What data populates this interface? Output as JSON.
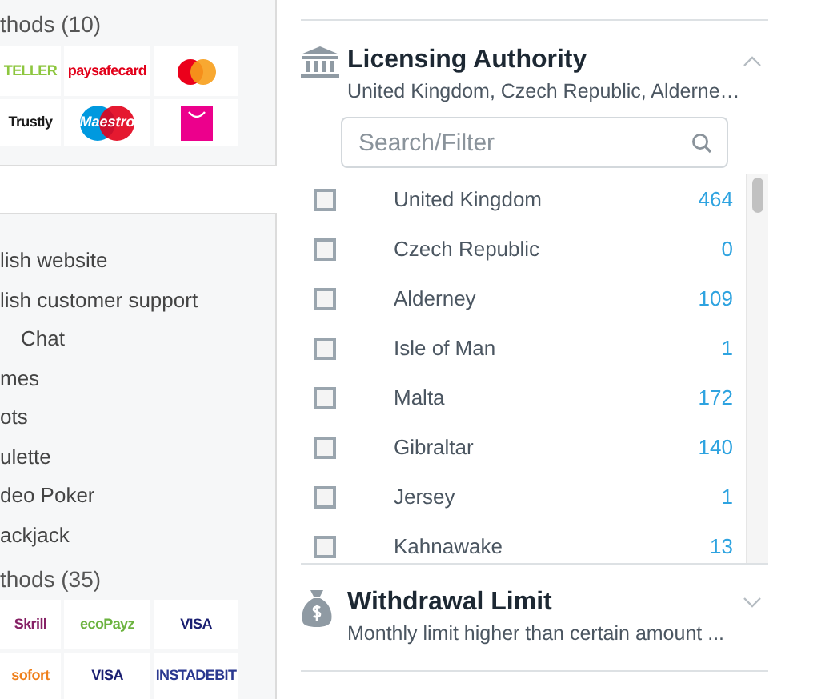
{
  "payment_card_top": {
    "heading": "thods (10)",
    "logos": [
      {
        "kind": "text",
        "text": "TELLER",
        "color": "#8dc63f"
      },
      {
        "kind": "text",
        "text": "paysafecard",
        "color": "#e2001a"
      },
      {
        "kind": "mastercard"
      },
      {
        "kind": "text",
        "text": "Trustly",
        "color": "#1a1a1a"
      },
      {
        "kind": "maestro",
        "text": "Maestro"
      },
      {
        "kind": "bag"
      }
    ]
  },
  "features_card": {
    "items": [
      {
        "text": "lish website",
        "indent": false
      },
      {
        "text": "lish customer support",
        "indent": false
      },
      {
        "text": "Chat",
        "indent": true
      },
      {
        "text": "mes",
        "indent": false
      },
      {
        "text": "ots",
        "indent": false
      },
      {
        "text": "ulette",
        "indent": false
      },
      {
        "text": "deo Poker",
        "indent": false
      },
      {
        "text": "ackjack",
        "indent": false
      }
    ],
    "payment_heading": "thods (35)",
    "logos": [
      {
        "kind": "text",
        "text": "Skrill",
        "color": "#862165"
      },
      {
        "kind": "text",
        "text": "ecoPayz",
        "color": "#6cb33f"
      },
      {
        "kind": "text",
        "text": "VISA",
        "color": "#1a1f71"
      },
      {
        "kind": "text",
        "text": "sofort",
        "color": "#ef7f1a"
      },
      {
        "kind": "text",
        "text": "VISA",
        "color": "#1a1f71"
      },
      {
        "kind": "text",
        "text": "INSTADEBIT",
        "color": "#2b3990"
      }
    ]
  },
  "filters": [
    {
      "kind": "bank",
      "title": "Licensing Authority",
      "summary": "United Kingdom, Czech Republic, Alderne…",
      "expanded": true,
      "search": {
        "placeholder": "Search/Filter"
      },
      "options": [
        {
          "label": "United Kingdom",
          "count": "464",
          "checked": false
        },
        {
          "label": "Czech Republic",
          "count": "0",
          "checked": false
        },
        {
          "label": "Alderney",
          "count": "109",
          "checked": false
        },
        {
          "label": "Isle of Man",
          "count": "1",
          "checked": false
        },
        {
          "label": "Malta",
          "count": "172",
          "checked": false
        },
        {
          "label": "Gibraltar",
          "count": "140",
          "checked": false
        },
        {
          "label": "Jersey",
          "count": "1",
          "checked": false
        },
        {
          "label": "Kahnawake",
          "count": "13",
          "checked": false
        }
      ]
    },
    {
      "kind": "money",
      "title": "Withdrawal Limit",
      "summary": "Monthly limit higher than certain amount ...",
      "expanded": false
    }
  ]
}
